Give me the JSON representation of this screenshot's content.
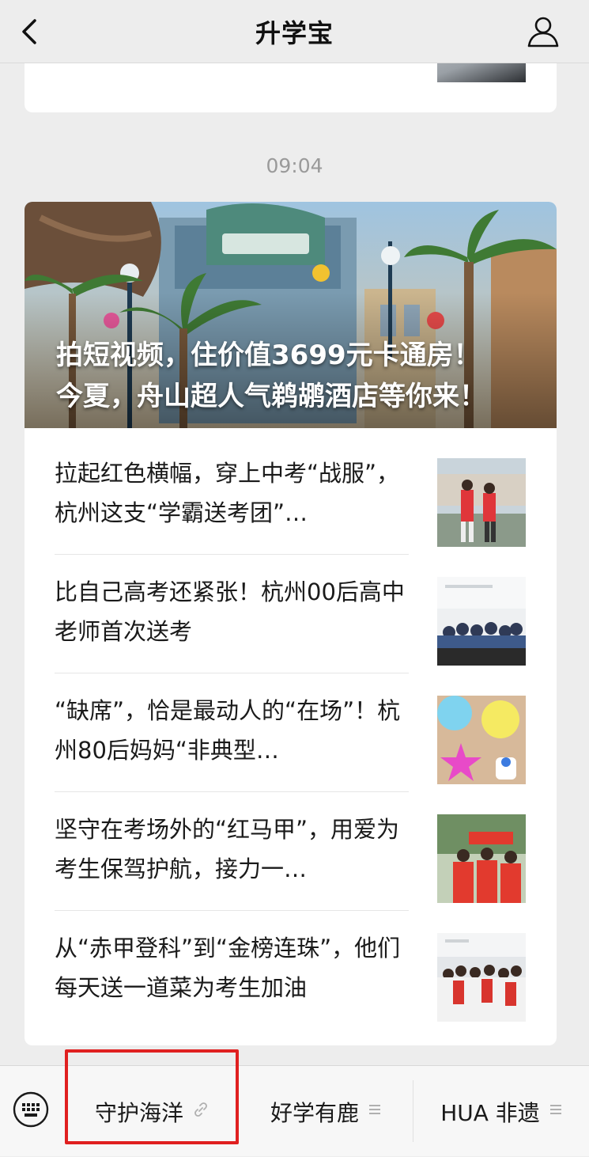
{
  "nav": {
    "title": "升学宝",
    "back_icon": "chevron-left-icon",
    "profile_icon": "person-icon"
  },
  "timestamp": "09:04",
  "hero": {
    "line1": "拍短视频，住价值3699元卡通房！",
    "line2": "今夏，舟山超人气鹈鹕酒店等你来！"
  },
  "articles": [
    {
      "title": "拉起红色横幅，穿上中考“战服”，杭州这支“学霸送考团”…"
    },
    {
      "title": "比自己高考还紧张！杭州00后高中老师首次送考"
    },
    {
      "title": "“缺席”，恰是最动人的“在场”！杭州80后妈妈“非典型…"
    },
    {
      "title": "坚守在考场外的“红马甲”，用爱为考生保驾护航，接力一…"
    },
    {
      "title": "从“赤甲登科”到“金榜连珠”，他们每天送一道菜为考生加油"
    }
  ],
  "bottom_menu": {
    "keyboard_icon": "keyboard-icon",
    "items": [
      {
        "label": "守护海洋",
        "icon": "link-icon"
      },
      {
        "label": "好学有鹿",
        "icon": "menu-lines-icon"
      },
      {
        "label": "HUA 非遗",
        "icon": "menu-lines-icon"
      }
    ]
  },
  "colors": {
    "background": "#ededed",
    "card": "#ffffff",
    "highlight": "#e02020",
    "timestamp": "#9a9a9a"
  }
}
